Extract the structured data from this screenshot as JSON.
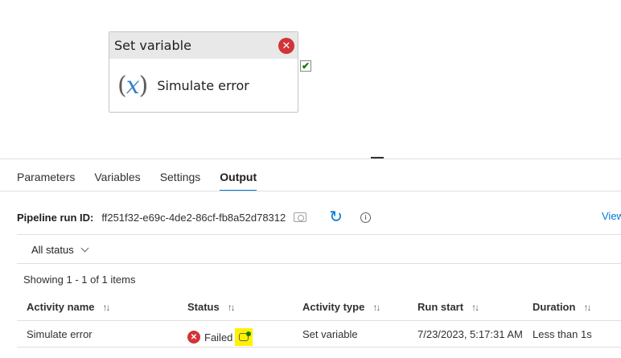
{
  "canvas": {
    "activity": {
      "type_label": "Set variable",
      "name": "Simulate error",
      "icon": "variable-icon",
      "status_icon": "error-icon",
      "success_port_icon": "checkmark-icon"
    }
  },
  "tabs": [
    {
      "label": "Parameters"
    },
    {
      "label": "Variables"
    },
    {
      "label": "Settings"
    },
    {
      "label": "Output",
      "active": true
    }
  ],
  "run": {
    "label": "Pipeline run ID:",
    "id": "ff251f32-e69c-4de2-86cf-fb8a52d78312",
    "view_details": "View de"
  },
  "filter": {
    "label": "All status"
  },
  "summary": "Showing 1 - 1 of 1 items",
  "table": {
    "headers": [
      "Activity name",
      "Status",
      "Activity type",
      "Run start",
      "Duration"
    ],
    "rows": [
      {
        "activity_name": "Simulate error",
        "status": "Failed",
        "activity_type": "Set variable",
        "run_start": "7/23/2023, 5:17:31 AM",
        "duration": "Less than 1s"
      }
    ]
  },
  "colors": {
    "accent": "#0078d4",
    "error": "#d13438",
    "success": "#107c10",
    "highlight": "#fff200"
  }
}
